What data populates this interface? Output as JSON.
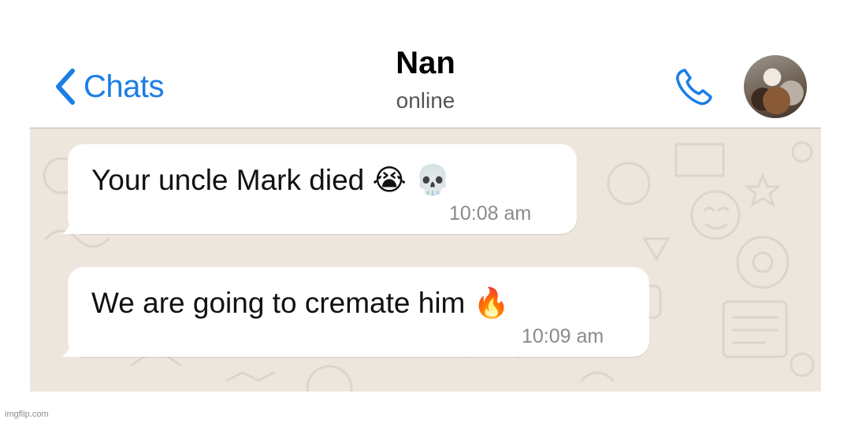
{
  "header": {
    "back_label": "Chats",
    "contact_name": "Nan",
    "status": "online"
  },
  "messages": [
    {
      "text": "Your uncle Mark died",
      "emoji": [
        "😭",
        "💀"
      ],
      "time": "10:08 am"
    },
    {
      "text": "We are going to cremate him",
      "emoji": [
        "🔥"
      ],
      "time": "10:09 am"
    }
  ],
  "watermark": "imgflip.com",
  "colors": {
    "accent": "#1a7ee6",
    "chat_background": "#ece6dd",
    "bubble": "#ffffff",
    "timestamp": "#8a8a8a"
  },
  "icons": [
    "chevron-left-icon",
    "phone-icon",
    "avatar"
  ]
}
